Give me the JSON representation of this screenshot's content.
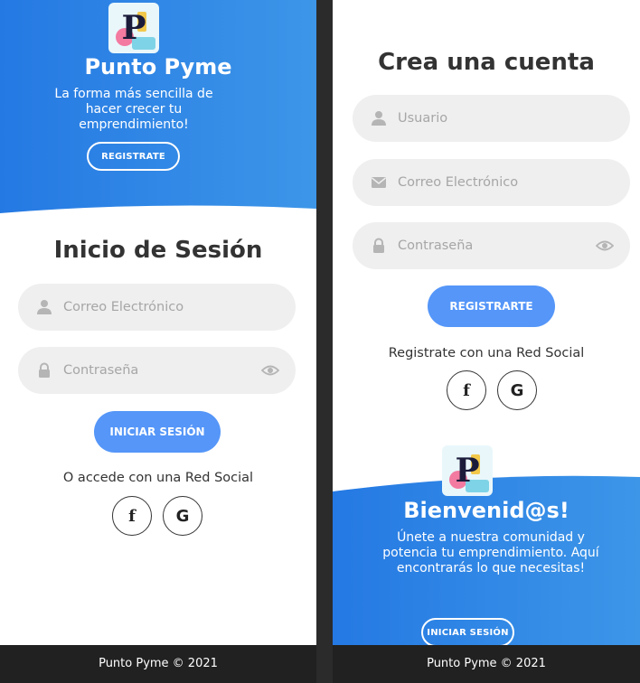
{
  "login_view": {
    "hero": {
      "app_name": "Punto Pyme",
      "tagline": "La forma más sencilla de hacer crecer tu emprendimiento!",
      "register_button": "REGISTRATE"
    },
    "form": {
      "title": "Inicio de Sesión",
      "email_placeholder": "Correo Electrónico",
      "password_placeholder": "Contraseña",
      "submit_button": "INICIAR SESIÓN",
      "social_text": "O accede con una Red Social",
      "facebook_label": "f",
      "google_label": "G"
    },
    "footer": "Punto Pyme © 2021"
  },
  "register_view": {
    "form": {
      "title": "Crea una cuenta",
      "user_placeholder": "Usuario",
      "email_placeholder": "Correo Electrónico",
      "password_placeholder": "Contraseña",
      "submit_button": "REGISTRARTE",
      "social_text": "Registrate con una Red Social",
      "facebook_label": "f",
      "google_label": "G"
    },
    "hero": {
      "welcome": "Bienvenid@s!",
      "message": "Únete a nuestra comunidad y potencia tu emprendimiento. Aquí encontrarás lo que necesitas!",
      "login_button": "INICIAR SESIÓN"
    },
    "footer": "Punto Pyme © 2021"
  },
  "colors": {
    "hero_gradient_start": "#2579e3",
    "hero_gradient_end": "#3d96e8",
    "primary_button": "#5596f8",
    "field_background": "#efefef",
    "footer_background": "#212121"
  },
  "icons": {
    "user": "user-icon",
    "email": "envelope-icon",
    "password": "lock-icon",
    "show_password": "eye-icon",
    "facebook": "facebook-icon",
    "google": "google-icon"
  }
}
